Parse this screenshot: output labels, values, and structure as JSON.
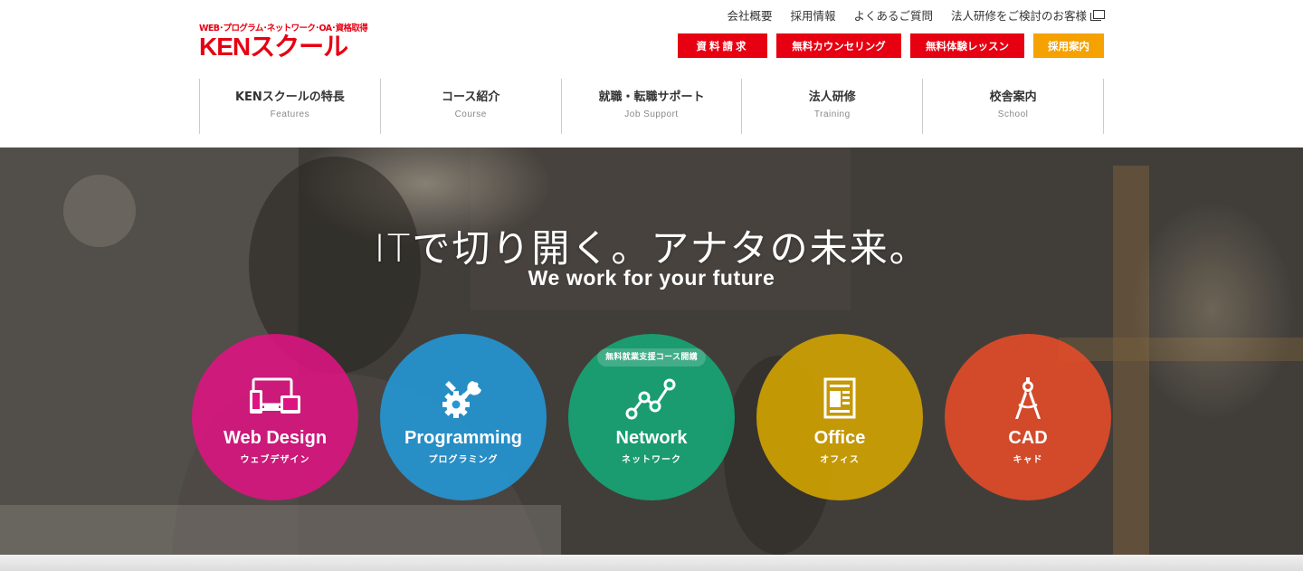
{
  "header": {
    "logo": {
      "tagline": "WEB･プログラム･ネットワーク･OA･資格取得",
      "brand": "KENスクール"
    },
    "util_links": [
      "会社概要",
      "採用情報",
      "よくあるご質問",
      "法人研修をご検討のお客様"
    ],
    "cta_buttons": {
      "request": "資料請求",
      "counseling": "無料カウンセリング",
      "trial": "無料体験レッスン",
      "recruit": "採用案内"
    },
    "nav": [
      {
        "jp": "KENスクールの特長",
        "en": "Features"
      },
      {
        "jp": "コース紹介",
        "en": "Course"
      },
      {
        "jp": "就職・転職サポート",
        "en": "Job Support"
      },
      {
        "jp": "法人研修",
        "en": "Training"
      },
      {
        "jp": "校舎案内",
        "en": "School"
      }
    ]
  },
  "hero": {
    "title": "ITで切り開く。アナタの未来。",
    "subtitle": "We work for your future",
    "courses": [
      {
        "en": "Web Design",
        "jp": "ウェブデザイン",
        "icon": "devices-icon",
        "color": "#de1382"
      },
      {
        "en": "Programming",
        "jp": "プログラミング",
        "icon": "gear-wrench-icon",
        "color": "#2398d8"
      },
      {
        "en": "Network",
        "jp": "ネットワーク",
        "icon": "network-nodes-icon",
        "color": "#14aa78",
        "badge": "無料就業支援コース開講"
      },
      {
        "en": "Office",
        "jp": "オフィス",
        "icon": "document-chart-icon",
        "color": "#d6a600"
      },
      {
        "en": "CAD",
        "jp": "キャド",
        "icon": "drafting-compass-icon",
        "color": "#e64c28"
      }
    ]
  },
  "colors": {
    "brand_red": "#e60012",
    "recruit_orange": "#f5a200"
  }
}
